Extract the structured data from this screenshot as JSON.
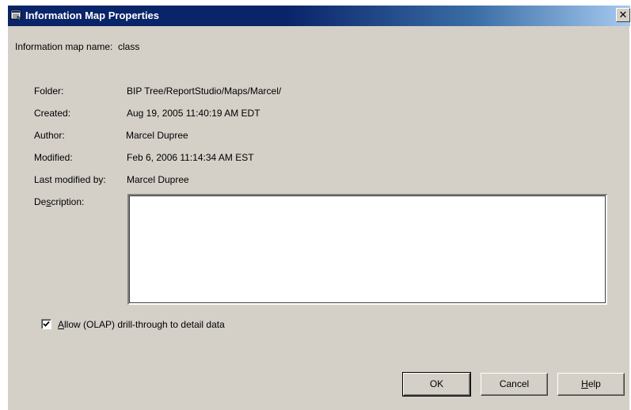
{
  "window": {
    "title": "Information Map Properties",
    "close_glyph": "✕"
  },
  "map_name": {
    "label": "Information map name:",
    "value": "class"
  },
  "fields": {
    "folder": {
      "label": "Folder:",
      "value": "BIP Tree/ReportStudio/Maps/Marcel/"
    },
    "created": {
      "label": "Created:",
      "value": "Aug 19, 2005 11:40:19 AM EDT"
    },
    "author": {
      "label": "Author:",
      "value": "Marcel Dupree"
    },
    "modified": {
      "label": "Modified:",
      "value": "Feb 6, 2006 11:14:34 AM EST"
    },
    "last_modified_by": {
      "label": "Last modified by:",
      "value": "Marcel Dupree"
    }
  },
  "description": {
    "label_pre": "De",
    "label_mnemonic": "s",
    "label_post": "cription:",
    "value": ""
  },
  "drillthrough": {
    "label_mnemonic": "A",
    "label_rest": "llow (OLAP) drill-through to detail data",
    "checked": true
  },
  "buttons": {
    "ok": "OK",
    "cancel": "Cancel",
    "help_mnemonic": "H",
    "help_rest": "elp"
  },
  "icons": {
    "title": "information-map-icon",
    "checkbox": "checkmark-icon"
  },
  "colors": {
    "titlebar": "#0a246a",
    "dialog_face": "#d4d0c8"
  }
}
